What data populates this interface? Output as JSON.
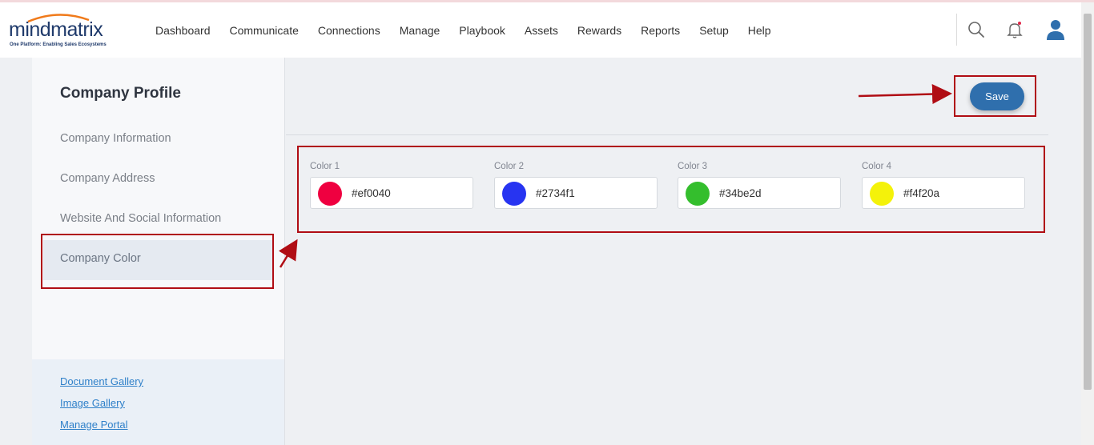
{
  "header": {
    "logo_text": "mindmatrix",
    "logo_tagline": "One Platform: Enabling Sales Ecosystems",
    "nav": [
      "Dashboard",
      "Communicate",
      "Connections",
      "Manage",
      "Playbook",
      "Assets",
      "Rewards",
      "Reports",
      "Setup",
      "Help"
    ],
    "icons": [
      "search-icon",
      "bell-icon",
      "user-icon"
    ]
  },
  "sidebar": {
    "title": "Company Profile",
    "items": [
      {
        "label": "Company Information"
      },
      {
        "label": "Company Address"
      },
      {
        "label": "Website And Social Information"
      },
      {
        "label": "Company Color",
        "active": true
      }
    ],
    "links": [
      "Document Gallery",
      "Image Gallery",
      "Manage Portal"
    ]
  },
  "main": {
    "save_label": "Save",
    "colors": [
      {
        "label": "Color 1",
        "value": "#ef0040",
        "swatch": "#ef0040"
      },
      {
        "label": "Color 2",
        "value": "#2734f1",
        "swatch": "#2734f1"
      },
      {
        "label": "Color 3",
        "value": "#34be2d",
        "swatch": "#34be2d"
      },
      {
        "label": "Color 4",
        "value": "#f4f20a",
        "swatch": "#f4f20a"
      }
    ]
  },
  "theme": {
    "accent": "#2f6fad",
    "annotation": "#b00d14"
  }
}
